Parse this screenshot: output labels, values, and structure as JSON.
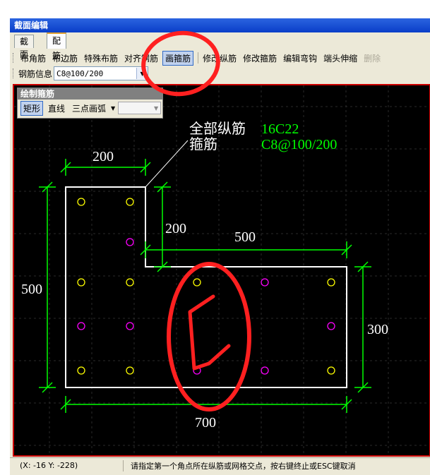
{
  "window": {
    "title": "截面编辑"
  },
  "tabs": [
    {
      "label": "截面",
      "active": false
    },
    {
      "label": "配筋",
      "active": true
    }
  ],
  "toolbar": {
    "buttons": [
      {
        "label": "布角筋"
      },
      {
        "label": "布边筋"
      },
      {
        "label": "特殊布筋"
      },
      {
        "label": "对齐钢筋"
      },
      {
        "label": "画箍筋",
        "active": true
      },
      {
        "label": "修改纵筋"
      },
      {
        "label": "修改箍筋"
      },
      {
        "label": "编辑弯钩"
      },
      {
        "label": "端头伸缩"
      },
      {
        "label": "删除",
        "disabled": true
      }
    ]
  },
  "rebar_info": {
    "label": "钢筋信息",
    "value": "C8@100/200"
  },
  "draw_panel": {
    "title": "绘制箍筋",
    "buttons": [
      {
        "label": "矩形",
        "active": true
      },
      {
        "label": "直线"
      },
      {
        "label": "三点画弧"
      }
    ],
    "dropdown_icon": "chevron-down-icon"
  },
  "drawing": {
    "label_all_long": "全部纵筋",
    "label_stirrup": "箍筋",
    "value_all_long": "16C22",
    "value_stirrup": "C8@100/200",
    "dims": {
      "top_width": "200",
      "notch_depth": "200",
      "right_width": "500",
      "height": "500",
      "right_height": "300",
      "bottom_width": "700"
    },
    "colors": {
      "outline": "#ffffff",
      "dim": "#00ff00",
      "label_white": "#ffffff",
      "label_green": "#00ff00",
      "bar_yellow": "#ffff00",
      "bar_magenta": "#ff00ff",
      "annotation": "#ff2020"
    }
  },
  "status": {
    "coords": "(X: -16 Y: -228)",
    "message": "请指定第一个角点所在纵筋或网格交点，按右键终止或ESC键取消"
  }
}
